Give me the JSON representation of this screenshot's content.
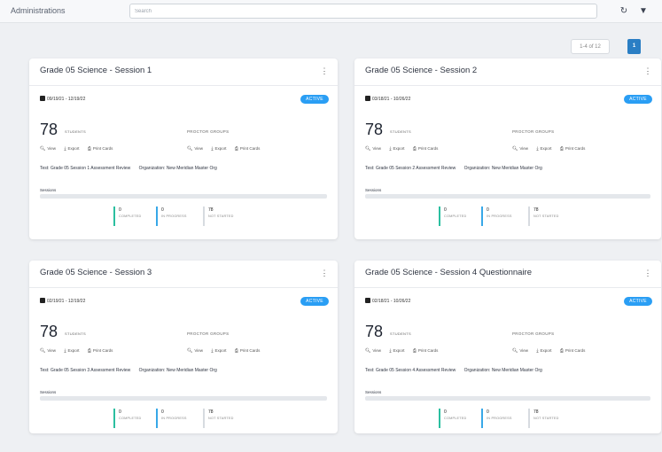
{
  "header": {
    "title": "Administrations",
    "search_placeholder": "Search",
    "icons": [
      "refresh-icon",
      "filter-icon"
    ]
  },
  "pager": {
    "info": "1-4 of 12",
    "current_page": "1"
  },
  "common": {
    "badge": "ACTIVE",
    "students_label": "STUDENTS",
    "proctor_groups_label": "PROCTOR GROUPS",
    "view": "View",
    "export": "Export",
    "print_cards": "Print Cards",
    "sessions_label": "Sessions",
    "completed_label": "COMPLETED",
    "in_progress_label": "IN PROGRESS",
    "not_started_label": "NOT STARTED",
    "organization_prefix": "Organization:",
    "organization": "New Meridian Master Org",
    "test_prefix": "Test:"
  },
  "cards": [
    {
      "title": "Grade 05 Science - Session 1",
      "dates": "09/19/21 - 12/19/22",
      "students": "78",
      "test": "Grade 05 Session 1 Assessment Review",
      "completed": "0",
      "in_progress": "0",
      "not_started": "78",
      "progress": 0
    },
    {
      "title": "Grade 05 Science - Session 2",
      "dates": "03/18/21 - 10/26/22",
      "students": "78",
      "test": "Grade 05 Session 2 Assessment Review",
      "completed": "0",
      "in_progress": "0",
      "not_started": "78",
      "progress": 0
    },
    {
      "title": "Grade 05 Science - Session 3",
      "dates": "02/19/21 - 12/19/22",
      "students": "78",
      "test": "Grade 05 Session 3 Assessment Review",
      "completed": "0",
      "in_progress": "0",
      "not_started": "78",
      "progress": 0
    },
    {
      "title": "Grade 05 Science - Session 4 Questionnaire",
      "dates": "02/18/21 - 10/26/22",
      "students": "78",
      "test": "Grade 05 Session 4 Assessment Review",
      "completed": "0",
      "in_progress": "0",
      "not_started": "78",
      "progress": 0
    }
  ],
  "colors": {
    "badge": "#2a9ef4",
    "completed_bar": "#2bbfa0",
    "in_progress_bar": "#38a8e8",
    "not_started_bar": "#d7dbe0",
    "page_active": "#2a7ec4"
  }
}
